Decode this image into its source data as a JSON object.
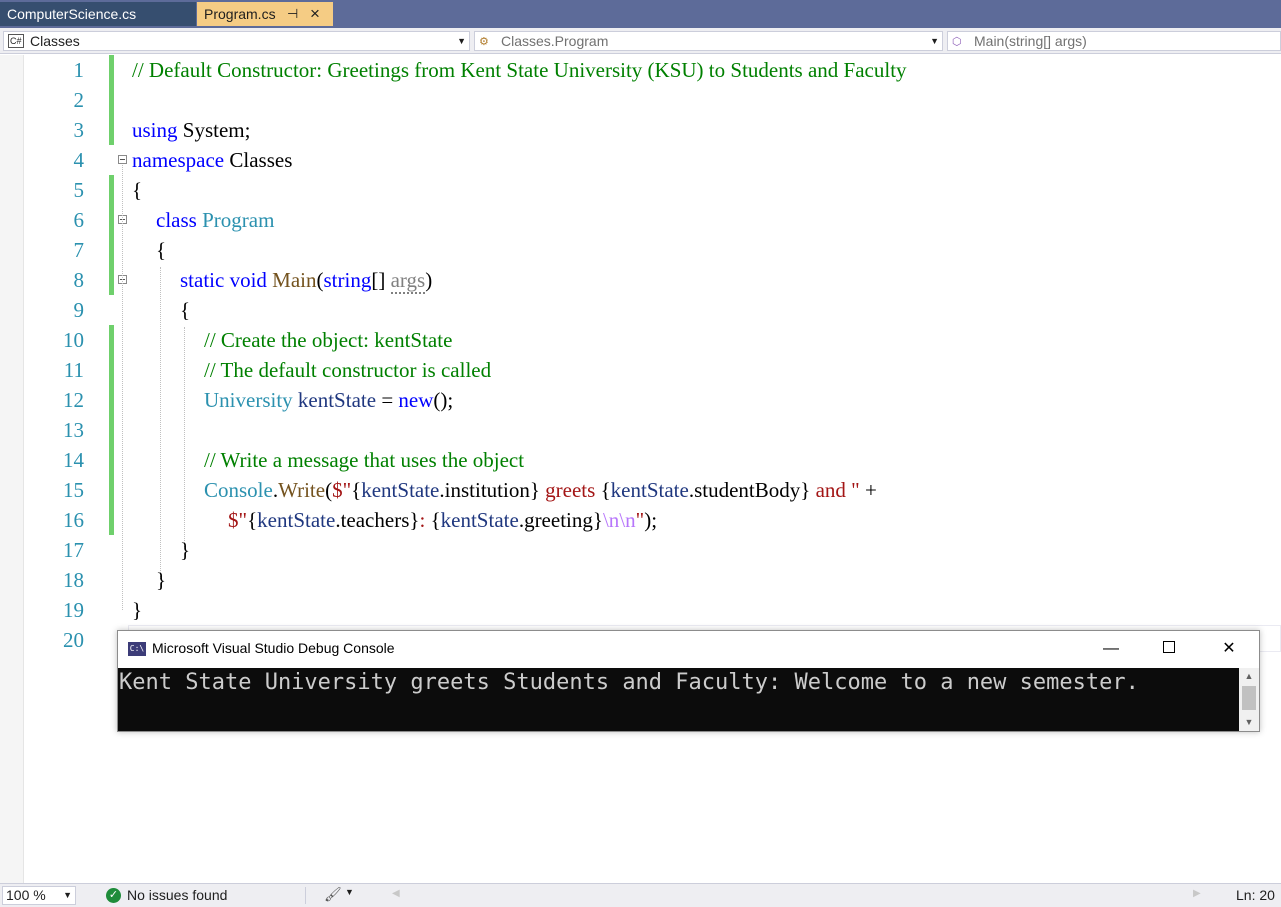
{
  "tabs": [
    {
      "label": "ComputerScience.cs",
      "active": false
    },
    {
      "label": "Program.cs",
      "active": true,
      "pin_icon": "pin-icon",
      "close_icon": "close-icon"
    }
  ],
  "navbar": {
    "project": "Classes",
    "project_icon_text": "C#",
    "class": "Classes.Program",
    "member": "Main(string[] args)"
  },
  "editor": {
    "line_numbers": [
      "1",
      "2",
      "3",
      "4",
      "5",
      "6",
      "7",
      "8",
      "9",
      "10",
      "11",
      "12",
      "13",
      "14",
      "15",
      "16",
      "17",
      "18",
      "19",
      "20"
    ],
    "code": {
      "l1_comment": "// Default Constructor: Greetings from Kent State University (KSU) to Students and Faculty",
      "l3_using": "using",
      "l3_system": " System;",
      "l4_namespace": "namespace",
      "l4_name": " Classes",
      "l5": "{",
      "l6_class": "class",
      "l6_name": "Program",
      "l7": "{",
      "l8_static": "static",
      "l8_void": "void",
      "l8_main": "Main",
      "l8_open": "(",
      "l8_string": "string",
      "l8_brackets": "[] ",
      "l8_args": "args",
      "l8_close": ")",
      "l9": "{",
      "l10_comment": "// Create the object: kentState",
      "l11_comment": "// The default constructor is called",
      "l12_type": "University",
      "l12_var": "kentState",
      "l12_eq": " = ",
      "l12_new": "new",
      "l12_end": "();",
      "l14_comment": "// Write a message that uses the object",
      "l15_console": "Console",
      "l15_dot": ".",
      "l15_write": "Write",
      "l15_open": "(",
      "l15_str1": "$\"",
      "l15_b1": "{",
      "l15_ks1": "kentState",
      "l15_inst": ".institution",
      "l15_b2": "}",
      "l15_greets": " greets ",
      "l15_b3": "{",
      "l15_ks2": "kentState",
      "l15_sb": ".studentBody",
      "l15_b4": "}",
      "l15_and": " and \"",
      "l15_plus": " +",
      "l16_str": "$\"",
      "l16_b1": "{",
      "l16_ks": "kentState",
      "l16_teachers": ".teachers",
      "l16_b2": "}",
      "l16_colon": ": ",
      "l16_b3": "{",
      "l16_ks2": "kentState",
      "l16_greeting": ".greeting",
      "l16_b4": "}",
      "l16_esc": "\\n\\n",
      "l16_q": "\"",
      "l16_end": ");",
      "l17": "}",
      "l18": "}",
      "l19": "}"
    }
  },
  "console": {
    "title": "Microsoft Visual Studio Debug Console",
    "icon_text": "C:\\",
    "output": "Kent State University greets Students and Faculty: Welcome to a new semester.",
    "minimize": "—",
    "close": "✕"
  },
  "statusbar": {
    "zoom": "100 %",
    "issues": "No issues found",
    "line": "Ln: 20"
  }
}
